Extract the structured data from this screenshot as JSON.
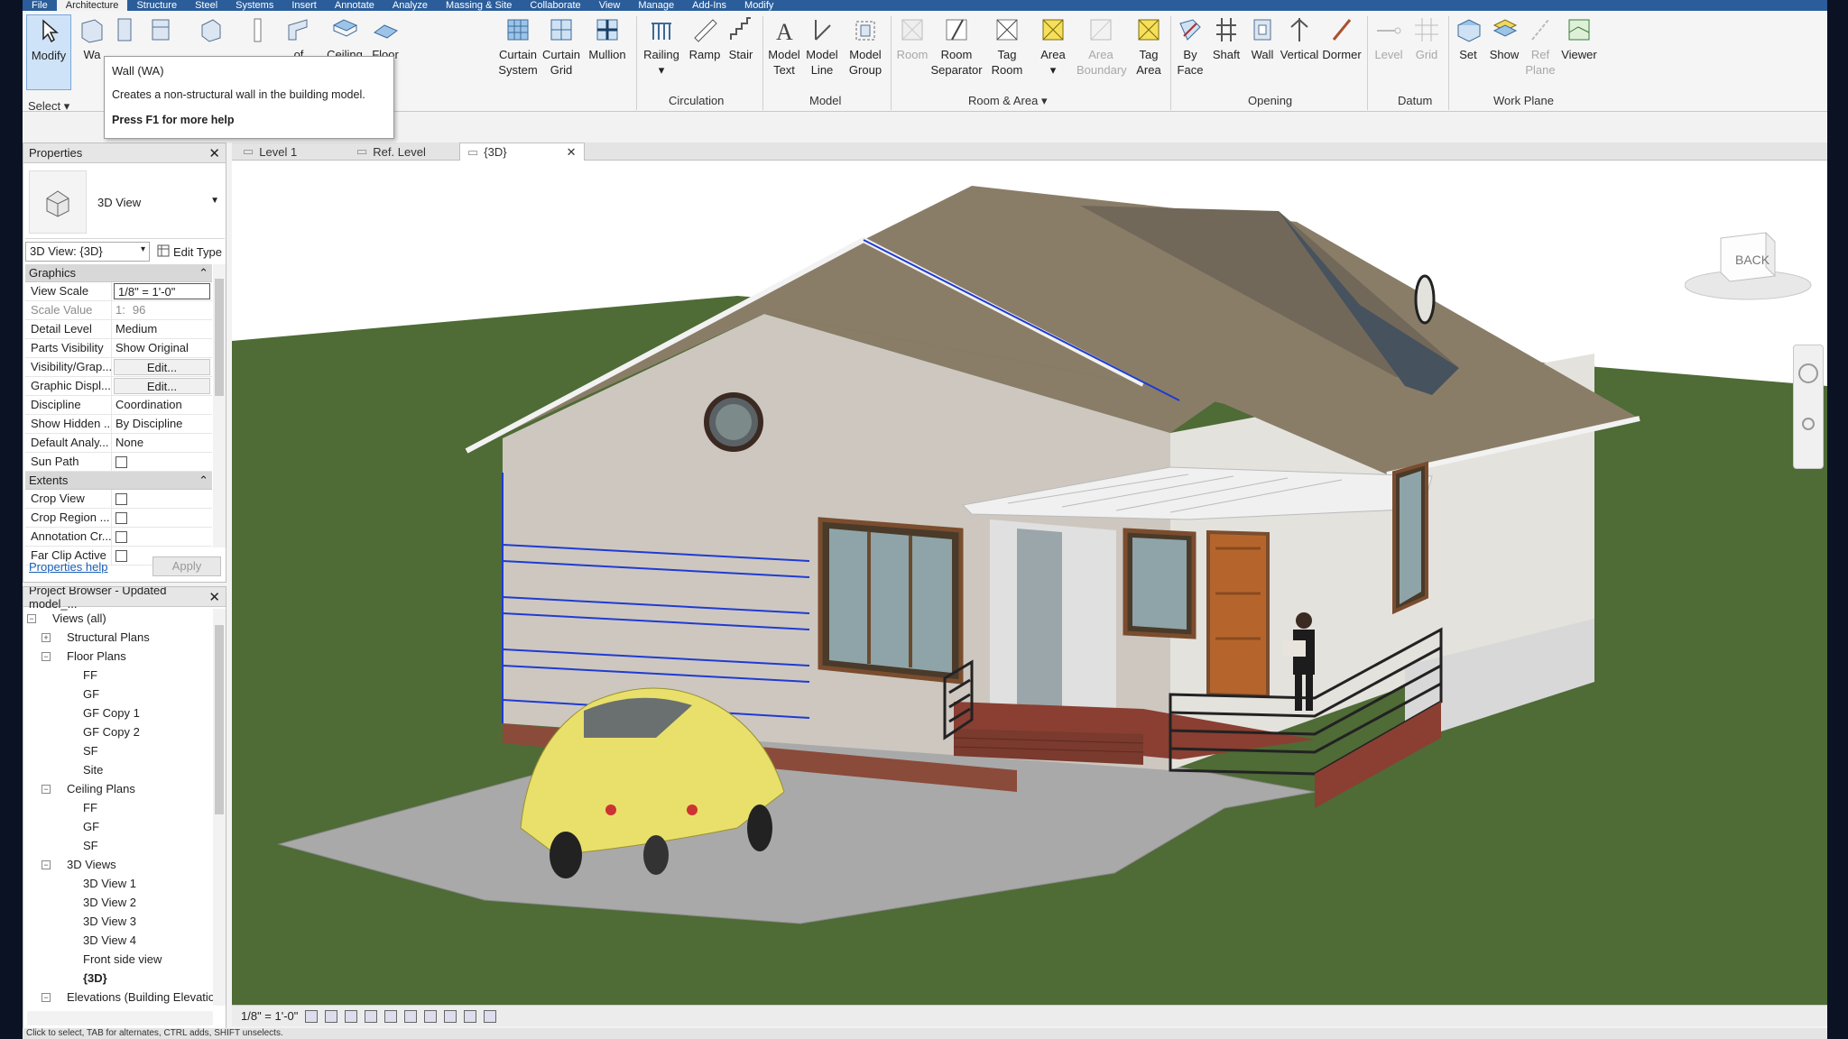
{
  "menubar": {
    "tabs": [
      "File",
      "Architecture",
      "Structure",
      "Steel",
      "Systems",
      "Insert",
      "Annotate",
      "Analyze",
      "Massing & Site",
      "Collaborate",
      "View",
      "Manage",
      "Add-Ins",
      "Modify"
    ]
  },
  "ribbon": {
    "modify": "Modify",
    "select": "Select",
    "wall_partial": "Wa",
    "roof_partial": "of",
    "buttons": {
      "ceiling": "Ceiling",
      "floor": "Floor",
      "curtain_system": "Curtain System",
      "curtain_grid": "Curtain Grid",
      "mullion": "Mullion",
      "railing": "Railing",
      "ramp": "Ramp",
      "stair": "Stair",
      "model_text": "Model Text",
      "model_line": "Model Line",
      "model_group": "Model Group",
      "room": "Room",
      "room_separator": "Room Separator",
      "tag_room": "Tag Room",
      "area": "Area",
      "area_boundary": "Area Boundary",
      "tag_area": "Tag Area",
      "by_face": "By Face",
      "shaft": "Shaft",
      "wall_opening": "Wall",
      "vertical": "Vertical",
      "dormer": "Dormer",
      "level": "Level",
      "grid": "Grid",
      "set": "Set",
      "show": "Show",
      "ref_plane": "Ref Plane",
      "viewer": "Viewer"
    },
    "panels": {
      "circulation": "Circulation",
      "model": "Model",
      "room_area": "Room & Area",
      "opening": "Opening",
      "datum": "Datum",
      "work_plane": "Work Plane"
    }
  },
  "tooltip": {
    "title": "Wall (WA)",
    "description": "Creates a non-structural wall in the building model.",
    "help": "Press F1 for more help"
  },
  "properties": {
    "title": "Properties",
    "type_name": "3D View",
    "instance": "3D View: {3D}",
    "edit_type": "Edit Type",
    "groups": {
      "graphics": "Graphics",
      "extents": "Extents"
    },
    "graphics_rows": [
      {
        "key": "View Scale",
        "value": "1/8\" = 1'-0\""
      },
      {
        "key": "Scale Value",
        "prefix": "1:",
        "value": "96"
      },
      {
        "key": "Detail Level",
        "value": "Medium"
      },
      {
        "key": "Parts Visibility",
        "value": "Show Original"
      },
      {
        "key": "Visibility/Grap...",
        "value": "Edit..."
      },
      {
        "key": "Graphic Displ...",
        "value": "Edit..."
      },
      {
        "key": "Discipline",
        "value": "Coordination"
      },
      {
        "key": "Show Hidden ...",
        "value": "By Discipline"
      },
      {
        "key": "Default Analy...",
        "value": "None"
      },
      {
        "key": "Sun Path",
        "value": ""
      }
    ],
    "extents_rows": [
      {
        "key": "Crop View"
      },
      {
        "key": "Crop Region ..."
      },
      {
        "key": "Annotation Cr..."
      },
      {
        "key": "Far Clip Active"
      }
    ],
    "help_link": "Properties help",
    "apply": "Apply"
  },
  "browser": {
    "title": "Project Browser - Updated model_...",
    "nodes": [
      {
        "label": "Views (all)",
        "level": 0,
        "toggle": "−"
      },
      {
        "label": "Structural Plans",
        "level": 1,
        "toggle": "+"
      },
      {
        "label": "Floor Plans",
        "level": 1,
        "toggle": "−"
      },
      {
        "label": "FF",
        "level": 2
      },
      {
        "label": "GF",
        "level": 2
      },
      {
        "label": "GF Copy 1",
        "level": 2
      },
      {
        "label": "GF Copy 2",
        "level": 2
      },
      {
        "label": "SF",
        "level": 2
      },
      {
        "label": "Site",
        "level": 2
      },
      {
        "label": "Ceiling Plans",
        "level": 1,
        "toggle": "−"
      },
      {
        "label": "FF",
        "level": 2
      },
      {
        "label": "GF",
        "level": 2
      },
      {
        "label": "SF",
        "level": 2
      },
      {
        "label": "3D Views",
        "level": 1,
        "toggle": "−"
      },
      {
        "label": "3D View 1",
        "level": 2
      },
      {
        "label": "3D View 2",
        "level": 2
      },
      {
        "label": "3D View 3",
        "level": 2
      },
      {
        "label": "3D View 4",
        "level": 2
      },
      {
        "label": "Front side view",
        "level": 2
      },
      {
        "label": "{3D}",
        "level": 2,
        "bold": true
      },
      {
        "label": "Elevations (Building Elevation",
        "level": 1,
        "toggle": "−"
      }
    ]
  },
  "view_tabs": [
    {
      "label": "Level 1"
    },
    {
      "label": "Ref. Level"
    },
    {
      "label": "{3D}",
      "active": true
    }
  ],
  "viewcube": {
    "face": "BACK"
  },
  "viewbar": {
    "scale": "1/8\" = 1'-0\""
  },
  "status": {
    "hint": "Click to select, TAB for alternates, CTRL adds, SHIFT unselects."
  },
  "colors": {
    "ribbon_accent": "#2a5d9a",
    "grass": "#4f6b36",
    "roof": "#8a7d68",
    "wall": "#cdc7c0",
    "car": "#e8e06a",
    "room_line": "#1f3bd1"
  }
}
